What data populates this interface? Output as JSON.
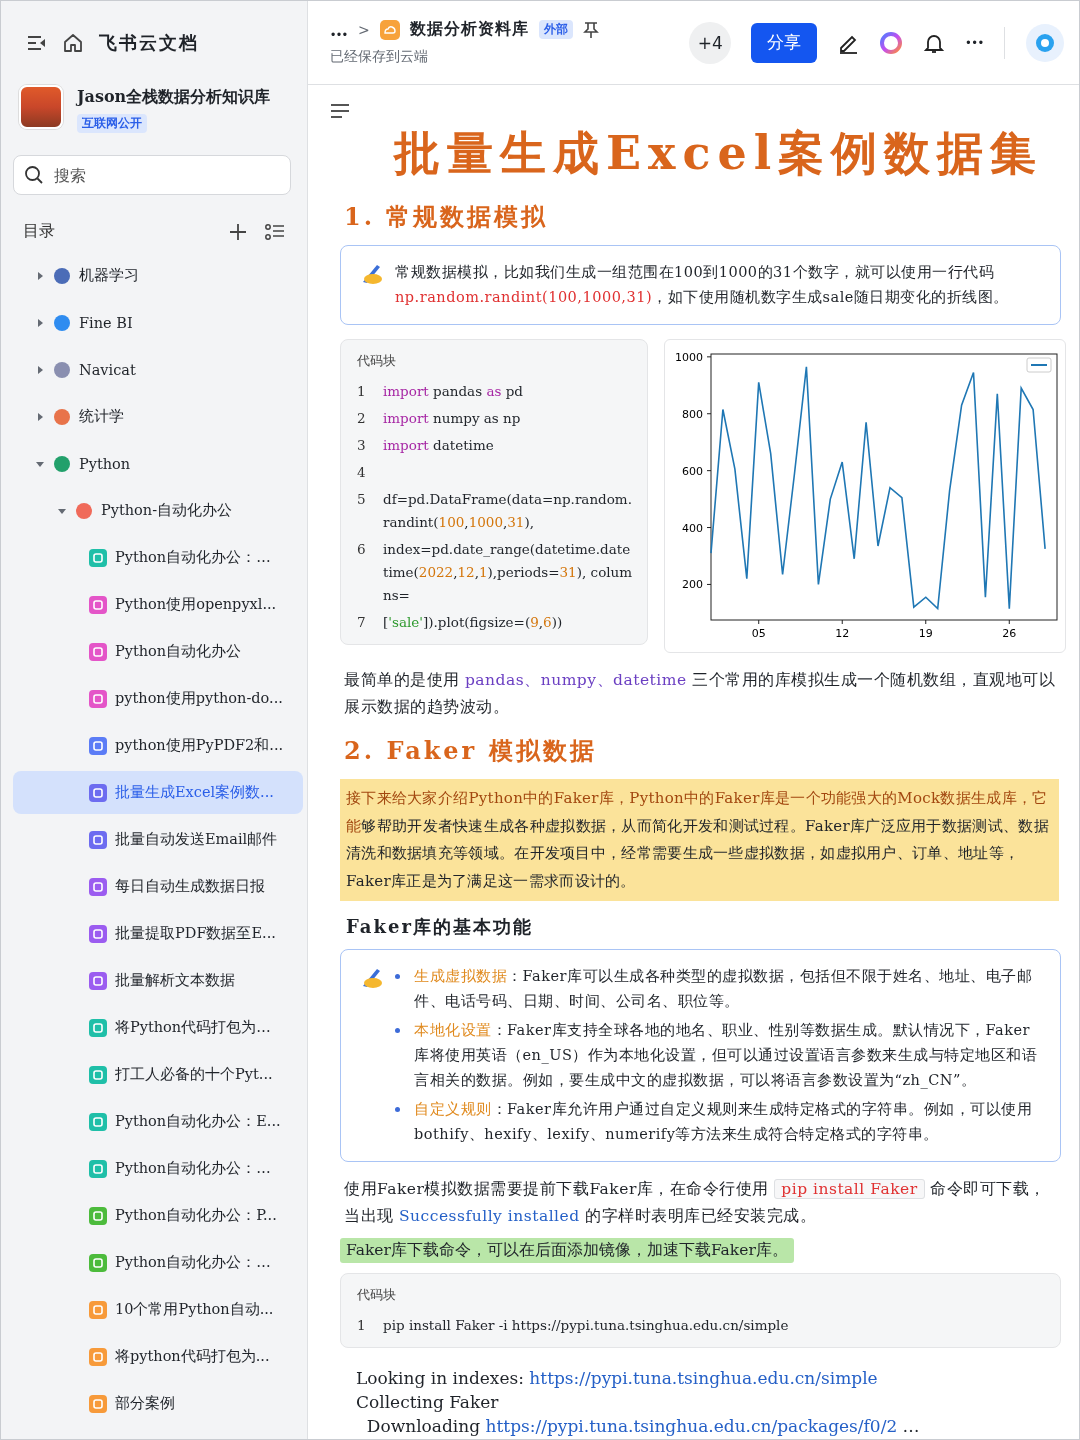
{
  "sidebar": {
    "app_title": "飞书云文档",
    "workspace": {
      "name": "Jason全栈数据分析知识库",
      "tag": "互联网公开"
    },
    "search": {
      "placeholder": "搜索"
    },
    "toc_label": "目录",
    "tree": [
      {
        "kind": "group",
        "label": "机器学习",
        "expanded": false,
        "selected": false,
        "color": "#4b6cb7"
      },
      {
        "kind": "group",
        "label": "Fine BI",
        "expanded": false,
        "selected": false,
        "color": "#2f8cf0"
      },
      {
        "kind": "group",
        "label": "Navicat",
        "expanded": false,
        "selected": false,
        "color": "#8a8fb0"
      },
      {
        "kind": "group",
        "label": "统计学",
        "expanded": false,
        "selected": false,
        "color": "#e8734a"
      },
      {
        "kind": "group",
        "label": "Python",
        "expanded": true,
        "selected": false,
        "color": "#22a06b",
        "children": [
          {
            "kind": "group",
            "label": "Python-自动化办公",
            "expanded": true,
            "selected": false,
            "color": "#f06a5a",
            "children": [
              {
                "kind": "page",
                "label": "Python自动化办公：…",
                "selected": false,
                "color": "#1fbfa8"
              },
              {
                "kind": "page",
                "label": "Python使用openpyxl...",
                "selected": false,
                "color": "#e455c8"
              },
              {
                "kind": "page",
                "label": "Python自动化办公",
                "selected": false,
                "color": "#e455c8"
              },
              {
                "kind": "page",
                "label": "python使用python-do...",
                "selected": false,
                "color": "#e455c8"
              },
              {
                "kind": "page",
                "label": "python使用PyPDF2和...",
                "selected": false,
                "color": "#5b7cf6"
              },
              {
                "kind": "page",
                "label": "批量生成Excel案例数...",
                "selected": true,
                "color": "#6d6cf0"
              },
              {
                "kind": "page",
                "label": "批量自动发送Email邮件",
                "selected": false,
                "color": "#6d6cf0"
              },
              {
                "kind": "page",
                "label": "每日自动生成数据日报",
                "selected": false,
                "color": "#9b5cf0"
              },
              {
                "kind": "page",
                "label": "批量提取PDF数据至E...",
                "selected": false,
                "color": "#9b5cf0"
              },
              {
                "kind": "page",
                "label": "批量解析文本数据",
                "selected": false,
                "color": "#9b5cf0"
              },
              {
                "kind": "page",
                "label": "将Python代码打包为…",
                "selected": false,
                "color": "#1fbfa8"
              },
              {
                "kind": "page",
                "label": "打工人必备的十个Pyt...",
                "selected": false,
                "color": "#1fbfa8"
              },
              {
                "kind": "page",
                "label": "Python自动化办公：E...",
                "selected": false,
                "color": "#1fbfa8"
              },
              {
                "kind": "page",
                "label": "Python自动化办公：…",
                "selected": false,
                "color": "#1fbfa8"
              },
              {
                "kind": "page",
                "label": "Python自动化办公：P...",
                "selected": false,
                "color": "#4cbb3c"
              },
              {
                "kind": "page",
                "label": "Python自动化办公：…",
                "selected": false,
                "color": "#4cbb3c"
              },
              {
                "kind": "page",
                "label": "10个常用Python自动...",
                "selected": false,
                "color": "#f79a3a"
              },
              {
                "kind": "page",
                "label": "将python代码打包为...",
                "selected": false,
                "color": "#f79a3a"
              },
              {
                "kind": "page",
                "label": "部分案例",
                "selected": false,
                "color": "#f79a3a"
              }
            ]
          }
        ]
      }
    ]
  },
  "header": {
    "breadcrumb_more": "…",
    "breadcrumb_separator": ">",
    "space": "数据分析资料库",
    "tag": "外部",
    "save_status": "已经保存到云端",
    "collaborators": "+4",
    "share": "分享",
    "more": "···"
  },
  "doc": {
    "title": "批量生成Excel案例数据集",
    "blocks": [
      {
        "kind": "h1",
        "text": "1. 常规数据模拟"
      },
      {
        "kind": "callout",
        "paragraphs": [
          [
            {
              "kind": "plain",
              "text": "常规数据模拟，比如我们生成一组范围在100到1000的31个数字，就可以使用一行代码"
            },
            {
              "kind": "code",
              "text": "np.random.randint(100,1000,31)"
            },
            {
              "kind": "plain",
              "text": "，如下使用随机数字生成sale随日期变化的折线图。"
            }
          ]
        ]
      },
      {
        "kind": "code_chart",
        "code": {
          "label": "代码块",
          "lines": [
            {
              "number": "1",
              "tokens": [
                {
                  "kind": "kw",
                  "text": "import"
                },
                {
                  "kind": "plain",
                  "text": " pandas "
                },
                {
                  "kind": "kw",
                  "text": "as"
                },
                {
                  "kind": "plain",
                  "text": " pd"
                }
              ]
            },
            {
              "number": "2",
              "tokens": [
                {
                  "kind": "kw",
                  "text": "import"
                },
                {
                  "kind": "plain",
                  "text": " numpy as np"
                }
              ]
            },
            {
              "number": "3",
              "tokens": [
                {
                  "kind": "kw",
                  "text": "import"
                },
                {
                  "kind": "plain",
                  "text": " datetime"
                }
              ]
            },
            {
              "number": "4"
            },
            {
              "number": "5",
              "tokens": [
                {
                  "kind": "plain",
                  "text": "df=pd.DataFrame(data=np.random.randint("
                },
                {
                  "kind": "num",
                  "text": "100"
                },
                {
                  "kind": "plain",
                  "text": ","
                },
                {
                  "kind": "num",
                  "text": "1000"
                },
                {
                  "kind": "plain",
                  "text": ","
                },
                {
                  "kind": "num",
                  "text": "31"
                },
                {
                  "kind": "plain",
                  "text": "),"
                }
              ]
            },
            {
              "number": "6",
              "tokens": [
                {
                  "kind": "plain",
                  "text": "index=pd.date_range(datetime.datetime("
                },
                {
                  "kind": "num",
                  "text": "2022"
                },
                {
                  "kind": "plain",
                  "text": ","
                },
                {
                  "kind": "num",
                  "text": "12"
                },
                {
                  "kind": "plain",
                  "text": ","
                },
                {
                  "kind": "num",
                  "text": "1"
                },
                {
                  "kind": "plain",
                  "text": "),periods="
                },
                {
                  "kind": "num",
                  "text": "31"
                },
                {
                  "kind": "plain",
                  "text": "), columns="
                }
              ]
            },
            {
              "number": "7",
              "tokens": [
                {
                  "kind": "plain",
                  "text": "["
                },
                {
                  "kind": "str",
                  "text": "'sale'"
                },
                {
                  "kind": "plain",
                  "text": "]).plot(figsize=("
                },
                {
                  "kind": "num",
                  "text": "9"
                },
                {
                  "kind": "plain",
                  "text": ","
                },
                {
                  "kind": "num",
                  "text": "6"
                },
                {
                  "kind": "plain",
                  "text": "))"
                }
              ]
            }
          ]
        },
        "chart_data": {
          "type": "line",
          "x": [
            1,
            2,
            3,
            4,
            5,
            6,
            7,
            8,
            9,
            10,
            11,
            12,
            13,
            14,
            15,
            16,
            17,
            18,
            19,
            20,
            21,
            22,
            23,
            24,
            25,
            26,
            27,
            28,
            29
          ],
          "series": [
            {
              "color": "#1f77b4",
              "values": [
                310,
                815,
                605,
                220,
                910,
                660,
                235,
                590,
                965,
                200,
                500,
                630,
                290,
                770,
                335,
                540,
                505,
                120,
                155,
                115,
                530,
                830,
                945,
                155,
                870,
                115,
                890,
                815,
                325
              ]
            }
          ],
          "xlim": [
            1,
            30
          ],
          "ylim": [
            75,
            1010
          ],
          "xticks": [
            {
              "value": 5,
              "label": "05"
            },
            {
              "value": 12,
              "label": "12"
            },
            {
              "value": 19,
              "label": "19"
            },
            {
              "value": 26,
              "label": "26"
            }
          ],
          "yticks": [
            200,
            400,
            600,
            800,
            1000
          ]
        }
      },
      {
        "kind": "p",
        "segments": [
          {
            "kind": "plain",
            "text": "最简单的是使用 "
          },
          {
            "kind": "lib",
            "text": "pandas、numpy、datetime"
          },
          {
            "kind": "plain",
            "text": " 三个常用的库模拟生成一个随机数组，直观地可以展示数据的趋势波动。"
          }
        ]
      },
      {
        "kind": "h1",
        "text": "2. Faker 模拟数据"
      },
      {
        "kind": "highlight",
        "color": "#fbe39a",
        "segments": [
          {
            "kind": "hl",
            "text": "接下来给大家介绍Python中的Faker库，Python中的Faker库是一个功能强大的Mock数据生成库，它能"
          },
          {
            "kind": "plain",
            "text": "够帮助开发者快速生成各种虚拟数据，从而简化开发和测试过程。Faker库广泛应用于数据测试、数据清洗和数据填充等领域。在开发项目中，经常需要生成一些虚拟数据，如虚拟用户、订单、地址等，Faker库正是为了满足这一需求而设计的。"
          }
        ]
      },
      {
        "kind": "h3",
        "text": "Faker库的基本功能"
      },
      {
        "kind": "callout",
        "bullets": true,
        "paragraphs": [
          [
            {
              "kind": "term",
              "text": "生成虚拟数据"
            },
            {
              "kind": "plain",
              "text": "：Faker库可以生成各种类型的虚拟数据，包括但不限于姓名、地址、电子邮件、电话号码、日期、时间、公司名、职位等。"
            }
          ],
          [
            {
              "kind": "term",
              "text": "本地化设置"
            },
            {
              "kind": "plain",
              "text": "：Faker库支持全球各地的地名、职业、性别等数据生成。默认情况下，Faker库将使用英语（en_US）作为本地化设置，但可以通过设置语言参数来生成与特定地区和语言相关的数据。例如，要生成中文的虚拟数据，可以将语言参数设置为“zh_CN”。"
            }
          ],
          [
            {
              "kind": "term",
              "text": "自定义规则"
            },
            {
              "kind": "plain",
              "text": "：Faker库允许用户通过自定义规则来生成特定格式的字符串。例如，可以使用bothify、hexify、lexify、numerify等方法来生成符合特定格式的字符串。"
            }
          ]
        ]
      },
      {
        "kind": "p",
        "segments": [
          {
            "kind": "plain",
            "text": "使用Faker模拟数据需要提前下载Faker库，在命令行使用 "
          },
          {
            "kind": "inline_code",
            "text": "pip install Faker"
          },
          {
            "kind": "plain",
            "text": " 命令即可下载，当出现 "
          },
          {
            "kind": "blue",
            "text": "Successfully installed"
          },
          {
            "kind": "plain",
            "text": " 的字样时表明库已经安装完成。"
          }
        ]
      },
      {
        "kind": "highlight",
        "color": "#b9e6a8",
        "segments": [
          {
            "kind": "plain",
            "text": "Faker库下载命令，可以在后面添加镜像，加速下载Faker库。"
          }
        ]
      },
      {
        "kind": "code",
        "label": "代码块",
        "lines": [
          {
            "number": "1",
            "tokens": [
              {
                "kind": "plain",
                "text": "pip install Faker -i https://pypi.tuna.tsinghua.edu.cn/simple"
              }
            ]
          }
        ]
      },
      {
        "kind": "output",
        "lines": [
          [
            {
              "kind": "plain",
              "text": "Looking in indexes: "
            },
            {
              "kind": "link",
              "text": "https://pypi.tuna.tsinghua.edu.cn/simple"
            }
          ],
          [
            {
              "kind": "plain",
              "text": "Collecting Faker"
            }
          ],
          [
            {
              "kind": "plain",
              "text": "  Downloading "
            },
            {
              "kind": "link",
              "text": "https://pypi.tuna.tsinghua.edu.cn/packages/f0/2"
            },
            {
              "kind": "plain",
              "text": " …"
            }
          ]
        ]
      }
    ]
  }
}
